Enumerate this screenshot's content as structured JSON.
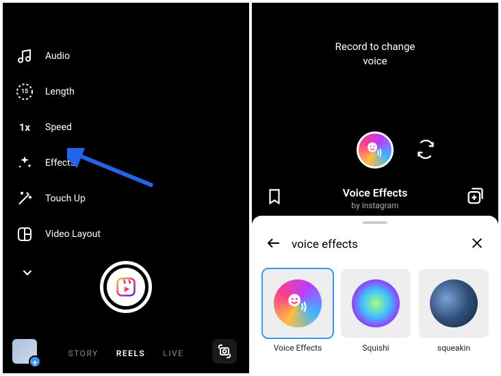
{
  "left": {
    "tools": [
      {
        "label": "Audio"
      },
      {
        "label": "Length"
      },
      {
        "label": "Speed"
      },
      {
        "label": "Effects"
      },
      {
        "label": "Touch Up"
      },
      {
        "label": "Video Layout"
      }
    ],
    "speed_value": "1x",
    "length_value": "15",
    "modes": {
      "story": "STORY",
      "reels": "REELS",
      "live": "LIVE"
    }
  },
  "right": {
    "hint": "Record to change\nvoice",
    "effect_title": "Voice Effects",
    "effect_subtitle": "by instagram",
    "search_query": "voice effects",
    "results": [
      {
        "label": "Voice Effects"
      },
      {
        "label": "Squishi"
      },
      {
        "label": "squeakin"
      }
    ]
  }
}
